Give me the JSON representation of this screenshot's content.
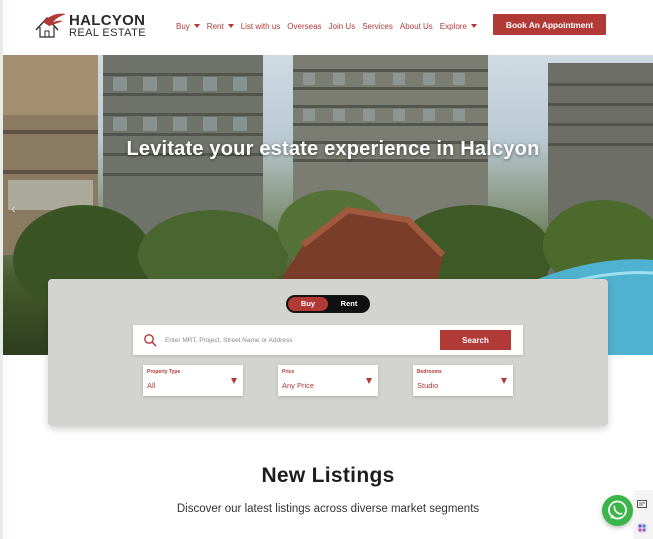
{
  "brand": {
    "name_top": "HALCYON",
    "name_bottom": "REAL ESTATE",
    "accent_color": "#b23a36"
  },
  "nav": {
    "items": [
      {
        "label": "Buy",
        "has_dropdown": true
      },
      {
        "label": "Rent",
        "has_dropdown": true
      },
      {
        "label": "List with us",
        "has_dropdown": false
      },
      {
        "label": "Overseas",
        "has_dropdown": false
      },
      {
        "label": "Join Us",
        "has_dropdown": false
      },
      {
        "label": "Services",
        "has_dropdown": false
      },
      {
        "label": "About Us",
        "has_dropdown": false
      },
      {
        "label": "Explore",
        "has_dropdown": true
      }
    ],
    "cta_label": "Book An Appointment"
  },
  "hero": {
    "title": "Levitate your estate experience in Halcyon",
    "prev_arrow": "‹"
  },
  "search": {
    "toggle": {
      "buy": "Buy",
      "rent": "Rent",
      "active": "Buy"
    },
    "placeholder": "Enter MRT, Project, Street Name or Address",
    "button_label": "Search",
    "filters": [
      {
        "label": "Property Type",
        "value": "All"
      },
      {
        "label": "Price",
        "value": "Any Price"
      },
      {
        "label": "Bedrooms",
        "value": "Studio"
      }
    ]
  },
  "listings": {
    "title": "New Listings",
    "subtitle": "Discover our latest listings across diverse market segments"
  },
  "icons": {
    "logo": "house-bird-logo-icon",
    "search": "search-icon",
    "chat": "whatsapp-icon"
  }
}
